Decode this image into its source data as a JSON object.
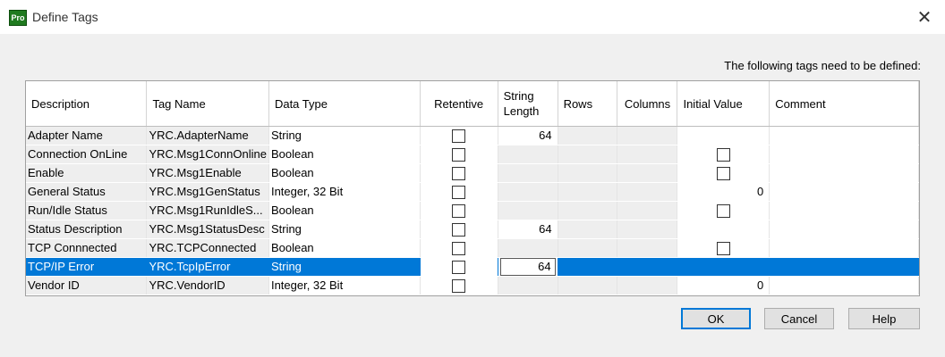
{
  "window": {
    "app_badge": "Pro",
    "title": "Define Tags"
  },
  "prompt": "The following tags need to be defined:",
  "columns": [
    "Description",
    "Tag Name",
    "Data Type",
    "Retentive",
    "String Length",
    "Rows",
    "Columns",
    "Initial Value",
    "Comment"
  ],
  "rows": [
    {
      "description": "Adapter Name",
      "tag_name": "YRC.AdapterName",
      "data_type": "String",
      "string_length": "64",
      "initial_value": "",
      "initial_checkbox": false
    },
    {
      "description": "Connection OnLine",
      "tag_name": "YRC.Msg1ConnOnline",
      "data_type": "Boolean",
      "string_length": "",
      "initial_value": "",
      "initial_checkbox": true
    },
    {
      "description": "Enable",
      "tag_name": "YRC.Msg1Enable",
      "data_type": "Boolean",
      "string_length": "",
      "initial_value": "",
      "initial_checkbox": true
    },
    {
      "description": "General Status",
      "tag_name": "YRC.Msg1GenStatus",
      "data_type": "Integer, 32 Bit",
      "string_length": "",
      "initial_value": "0",
      "initial_checkbox": false
    },
    {
      "description": "Run/Idle Status",
      "tag_name": "YRC.Msg1RunIdleS...",
      "data_type": "Boolean",
      "string_length": "",
      "initial_value": "",
      "initial_checkbox": true
    },
    {
      "description": "Status Description",
      "tag_name": "YRC.Msg1StatusDesc",
      "data_type": "String",
      "string_length": "64",
      "initial_value": "",
      "initial_checkbox": false
    },
    {
      "description": "TCP Connnected",
      "tag_name": "YRC.TCPConnected",
      "data_type": "Boolean",
      "string_length": "",
      "initial_value": "",
      "initial_checkbox": true
    },
    {
      "description": "TCP/IP Error",
      "tag_name": "YRC.TcpIpError",
      "data_type": "String",
      "string_length": "64",
      "initial_value": "",
      "initial_checkbox": false,
      "selected": true
    },
    {
      "description": "Vendor ID",
      "tag_name": "YRC.VendorID",
      "data_type": "Integer, 32 Bit",
      "string_length": "",
      "initial_value": "0",
      "initial_checkbox": false
    }
  ],
  "buttons": {
    "ok": "OK",
    "cancel": "Cancel",
    "help": "Help"
  },
  "colors": {
    "selection": "#0078d7",
    "readonly_cell": "#eeeeee"
  }
}
